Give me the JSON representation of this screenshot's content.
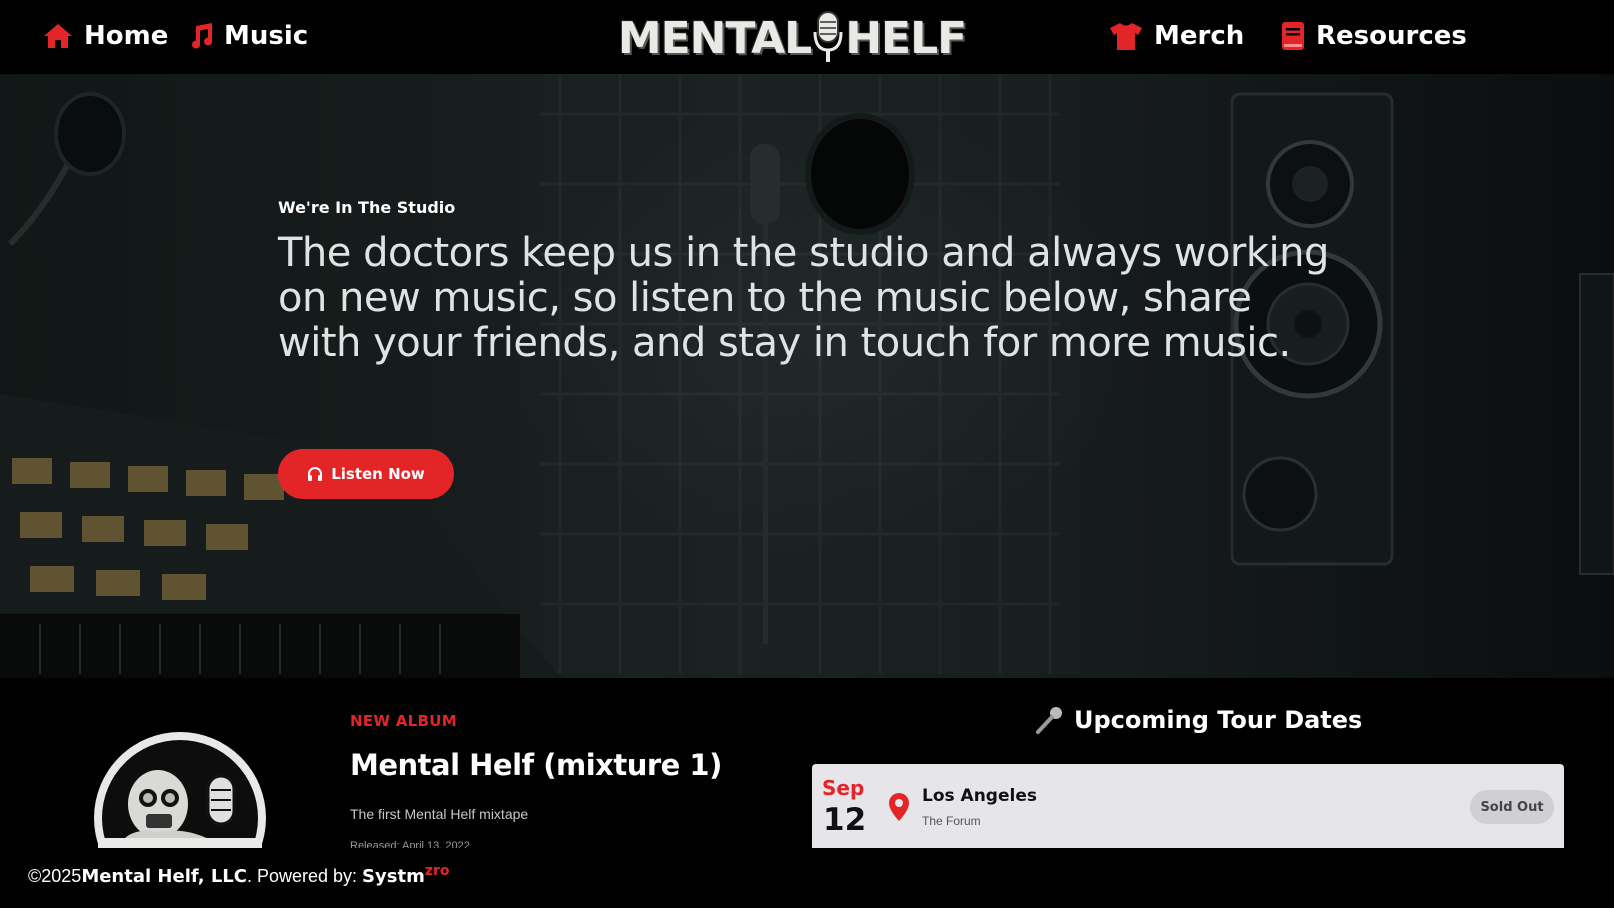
{
  "nav": {
    "home": "Home",
    "music": "Music",
    "merch": "Merch",
    "resources": "Resources",
    "logo_left": "MENTAL",
    "logo_right": "HELF",
    "icon_color": "#e42528"
  },
  "hero": {
    "eyebrow": "We're In The Studio",
    "text": "The doctors keep us in the studio and always working on new music, so listen to the music below, share with your friends, and stay in touch for more music.",
    "button": "Listen Now"
  },
  "album": {
    "label": "NEW ALBUM",
    "title": "Mental Helf (mixture 1)",
    "description": "The first Mental Helf mixtape",
    "released": "Released: April 13, 2022"
  },
  "tour": {
    "title": "Upcoming Tour Dates",
    "dates": [
      {
        "month": "Sep",
        "day": "12",
        "city": "Los Angeles",
        "venue": "The Forum",
        "status": "Sold Out"
      }
    ]
  },
  "footer": {
    "copyright": "©2025",
    "company": "Mental Helf, LLC",
    "powered": ". Powered by: ",
    "brand": "Systm",
    "brand_sup": "zro"
  },
  "icons": [
    "home-icon",
    "music-note-icon",
    "tshirt-icon",
    "book-icon",
    "microphone-icon",
    "headphones-icon",
    "location-pin-icon"
  ]
}
